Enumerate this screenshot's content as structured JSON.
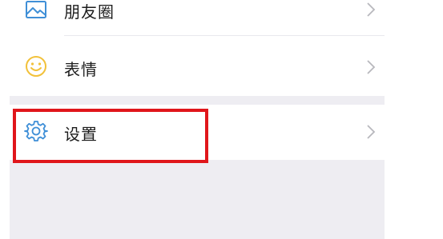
{
  "menu": {
    "items": [
      {
        "label": "朋友圈",
        "icon": "image-icon"
      },
      {
        "label": "表情",
        "icon": "smiley-icon"
      },
      {
        "label": "设置",
        "icon": "gear-icon"
      }
    ]
  },
  "colors": {
    "background": "#eeedf2",
    "row_background": "#ffffff",
    "image_icon": "#3f8fd7",
    "smiley_icon": "#f2c13a",
    "gear_icon": "#3f8fd7",
    "chevron": "#b8b8bd",
    "highlight_border": "#e0161b"
  },
  "highlighted_item": "设置"
}
